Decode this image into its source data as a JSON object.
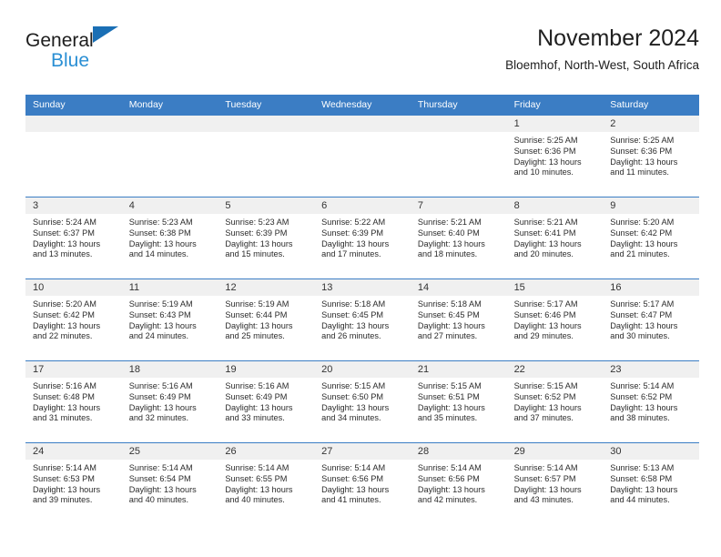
{
  "brand": {
    "name_part1": "General",
    "name_part2": "Blue",
    "triangle_color": "#1a6fb5",
    "blue_text_color": "#2a8fd4"
  },
  "header": {
    "month_title": "November 2024",
    "location": "Bloemhof, North-West, South Africa"
  },
  "theme": {
    "header_bar_color": "#3b7dc4",
    "day_band_color": "#f0f0f0",
    "text_color": "#2b2b2b"
  },
  "weekdays": [
    "Sunday",
    "Monday",
    "Tuesday",
    "Wednesday",
    "Thursday",
    "Friday",
    "Saturday"
  ],
  "weeks": [
    [
      {
        "day": "",
        "empty": true,
        "sunrise": "",
        "sunset": "",
        "daylight1": "",
        "daylight2": ""
      },
      {
        "day": "",
        "empty": true,
        "sunrise": "",
        "sunset": "",
        "daylight1": "",
        "daylight2": ""
      },
      {
        "day": "",
        "empty": true,
        "sunrise": "",
        "sunset": "",
        "daylight1": "",
        "daylight2": ""
      },
      {
        "day": "",
        "empty": true,
        "sunrise": "",
        "sunset": "",
        "daylight1": "",
        "daylight2": ""
      },
      {
        "day": "",
        "empty": true,
        "sunrise": "",
        "sunset": "",
        "daylight1": "",
        "daylight2": ""
      },
      {
        "day": "1",
        "sunrise": "Sunrise: 5:25 AM",
        "sunset": "Sunset: 6:36 PM",
        "daylight1": "Daylight: 13 hours",
        "daylight2": "and 10 minutes."
      },
      {
        "day": "2",
        "sunrise": "Sunrise: 5:25 AM",
        "sunset": "Sunset: 6:36 PM",
        "daylight1": "Daylight: 13 hours",
        "daylight2": "and 11 minutes."
      }
    ],
    [
      {
        "day": "3",
        "sunrise": "Sunrise: 5:24 AM",
        "sunset": "Sunset: 6:37 PM",
        "daylight1": "Daylight: 13 hours",
        "daylight2": "and 13 minutes."
      },
      {
        "day": "4",
        "sunrise": "Sunrise: 5:23 AM",
        "sunset": "Sunset: 6:38 PM",
        "daylight1": "Daylight: 13 hours",
        "daylight2": "and 14 minutes."
      },
      {
        "day": "5",
        "sunrise": "Sunrise: 5:23 AM",
        "sunset": "Sunset: 6:39 PM",
        "daylight1": "Daylight: 13 hours",
        "daylight2": "and 15 minutes."
      },
      {
        "day": "6",
        "sunrise": "Sunrise: 5:22 AM",
        "sunset": "Sunset: 6:39 PM",
        "daylight1": "Daylight: 13 hours",
        "daylight2": "and 17 minutes."
      },
      {
        "day": "7",
        "sunrise": "Sunrise: 5:21 AM",
        "sunset": "Sunset: 6:40 PM",
        "daylight1": "Daylight: 13 hours",
        "daylight2": "and 18 minutes."
      },
      {
        "day": "8",
        "sunrise": "Sunrise: 5:21 AM",
        "sunset": "Sunset: 6:41 PM",
        "daylight1": "Daylight: 13 hours",
        "daylight2": "and 20 minutes."
      },
      {
        "day": "9",
        "sunrise": "Sunrise: 5:20 AM",
        "sunset": "Sunset: 6:42 PM",
        "daylight1": "Daylight: 13 hours",
        "daylight2": "and 21 minutes."
      }
    ],
    [
      {
        "day": "10",
        "sunrise": "Sunrise: 5:20 AM",
        "sunset": "Sunset: 6:42 PM",
        "daylight1": "Daylight: 13 hours",
        "daylight2": "and 22 minutes."
      },
      {
        "day": "11",
        "sunrise": "Sunrise: 5:19 AM",
        "sunset": "Sunset: 6:43 PM",
        "daylight1": "Daylight: 13 hours",
        "daylight2": "and 24 minutes."
      },
      {
        "day": "12",
        "sunrise": "Sunrise: 5:19 AM",
        "sunset": "Sunset: 6:44 PM",
        "daylight1": "Daylight: 13 hours",
        "daylight2": "and 25 minutes."
      },
      {
        "day": "13",
        "sunrise": "Sunrise: 5:18 AM",
        "sunset": "Sunset: 6:45 PM",
        "daylight1": "Daylight: 13 hours",
        "daylight2": "and 26 minutes."
      },
      {
        "day": "14",
        "sunrise": "Sunrise: 5:18 AM",
        "sunset": "Sunset: 6:45 PM",
        "daylight1": "Daylight: 13 hours",
        "daylight2": "and 27 minutes."
      },
      {
        "day": "15",
        "sunrise": "Sunrise: 5:17 AM",
        "sunset": "Sunset: 6:46 PM",
        "daylight1": "Daylight: 13 hours",
        "daylight2": "and 29 minutes."
      },
      {
        "day": "16",
        "sunrise": "Sunrise: 5:17 AM",
        "sunset": "Sunset: 6:47 PM",
        "daylight1": "Daylight: 13 hours",
        "daylight2": "and 30 minutes."
      }
    ],
    [
      {
        "day": "17",
        "sunrise": "Sunrise: 5:16 AM",
        "sunset": "Sunset: 6:48 PM",
        "daylight1": "Daylight: 13 hours",
        "daylight2": "and 31 minutes."
      },
      {
        "day": "18",
        "sunrise": "Sunrise: 5:16 AM",
        "sunset": "Sunset: 6:49 PM",
        "daylight1": "Daylight: 13 hours",
        "daylight2": "and 32 minutes."
      },
      {
        "day": "19",
        "sunrise": "Sunrise: 5:16 AM",
        "sunset": "Sunset: 6:49 PM",
        "daylight1": "Daylight: 13 hours",
        "daylight2": "and 33 minutes."
      },
      {
        "day": "20",
        "sunrise": "Sunrise: 5:15 AM",
        "sunset": "Sunset: 6:50 PM",
        "daylight1": "Daylight: 13 hours",
        "daylight2": "and 34 minutes."
      },
      {
        "day": "21",
        "sunrise": "Sunrise: 5:15 AM",
        "sunset": "Sunset: 6:51 PM",
        "daylight1": "Daylight: 13 hours",
        "daylight2": "and 35 minutes."
      },
      {
        "day": "22",
        "sunrise": "Sunrise: 5:15 AM",
        "sunset": "Sunset: 6:52 PM",
        "daylight1": "Daylight: 13 hours",
        "daylight2": "and 37 minutes."
      },
      {
        "day": "23",
        "sunrise": "Sunrise: 5:14 AM",
        "sunset": "Sunset: 6:52 PM",
        "daylight1": "Daylight: 13 hours",
        "daylight2": "and 38 minutes."
      }
    ],
    [
      {
        "day": "24",
        "sunrise": "Sunrise: 5:14 AM",
        "sunset": "Sunset: 6:53 PM",
        "daylight1": "Daylight: 13 hours",
        "daylight2": "and 39 minutes."
      },
      {
        "day": "25",
        "sunrise": "Sunrise: 5:14 AM",
        "sunset": "Sunset: 6:54 PM",
        "daylight1": "Daylight: 13 hours",
        "daylight2": "and 40 minutes."
      },
      {
        "day": "26",
        "sunrise": "Sunrise: 5:14 AM",
        "sunset": "Sunset: 6:55 PM",
        "daylight1": "Daylight: 13 hours",
        "daylight2": "and 40 minutes."
      },
      {
        "day": "27",
        "sunrise": "Sunrise: 5:14 AM",
        "sunset": "Sunset: 6:56 PM",
        "daylight1": "Daylight: 13 hours",
        "daylight2": "and 41 minutes."
      },
      {
        "day": "28",
        "sunrise": "Sunrise: 5:14 AM",
        "sunset": "Sunset: 6:56 PM",
        "daylight1": "Daylight: 13 hours",
        "daylight2": "and 42 minutes."
      },
      {
        "day": "29",
        "sunrise": "Sunrise: 5:14 AM",
        "sunset": "Sunset: 6:57 PM",
        "daylight1": "Daylight: 13 hours",
        "daylight2": "and 43 minutes."
      },
      {
        "day": "30",
        "sunrise": "Sunrise: 5:13 AM",
        "sunset": "Sunset: 6:58 PM",
        "daylight1": "Daylight: 13 hours",
        "daylight2": "and 44 minutes."
      }
    ]
  ]
}
